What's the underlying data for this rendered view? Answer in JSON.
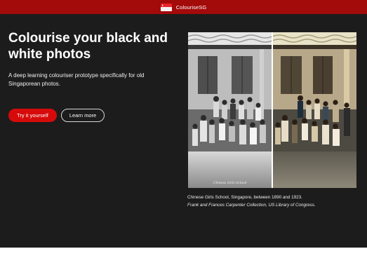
{
  "topbar": {
    "brand": "ColouriseSG",
    "flag_icon": "singapore-flag-icon",
    "color": "#a30a0a"
  },
  "hero": {
    "title": "Colourise your black and white photos",
    "description": "A deep learning colouriser prototype specifically for old Singaporean photos.",
    "primary_button": "Try it yourself",
    "secondary_button": "Learn more",
    "background": "#1c1c1c",
    "accent": "#d60a0a"
  },
  "photo": {
    "handwritten_caption": "Chinese Girls School",
    "comparison": {
      "left": "black-and-white original",
      "right": "colourised version"
    }
  },
  "caption": {
    "line1": "Chinese Girls School, Singapore, between 1890 and 1923.",
    "line2": "Frank and Frances Carpenter Collection, US Library of Congress."
  }
}
